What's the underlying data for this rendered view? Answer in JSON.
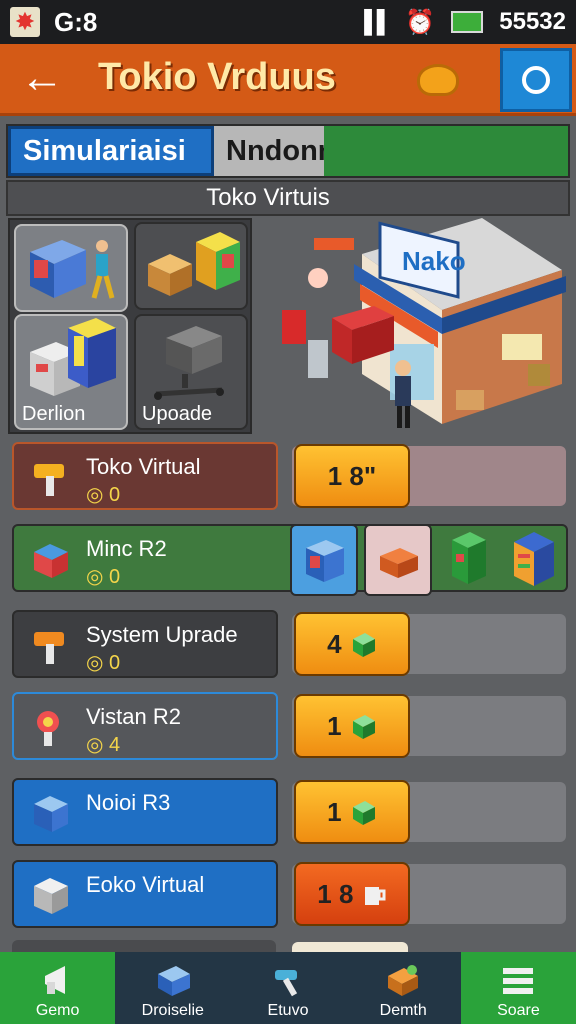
{
  "status": {
    "left_text": "G:8",
    "right_text": "55532"
  },
  "header": {
    "title": "Tokio Vrduus"
  },
  "tabs": [
    {
      "label": "Simulariaisi"
    },
    {
      "label": "Nndonnsial"
    },
    {
      "label": ""
    }
  ],
  "subheader": "Toko Virtuis",
  "categories": [
    {
      "label": ""
    },
    {
      "label": ""
    },
    {
      "label": "Derlion"
    },
    {
      "label": "Upoade"
    }
  ],
  "scene": {
    "sign": "Nako"
  },
  "items": [
    {
      "name": "Toko Virtual",
      "price": "0",
      "button": "1 8\""
    },
    {
      "name": "Minc R2",
      "price": "0",
      "button": ""
    },
    {
      "name": "System Uprade",
      "price": "0",
      "button": "4"
    },
    {
      "name": "Vistan R2",
      "price": "4",
      "button": "1"
    },
    {
      "name": "Noioi R3",
      "price": "",
      "button": "1"
    },
    {
      "name": "Eoko Virtual",
      "price": "",
      "button": "1 8"
    }
  ],
  "nav": [
    {
      "label": "Gemo",
      "icon": "megaphone-icon"
    },
    {
      "label": "Droiselie",
      "icon": "monitor-icon"
    },
    {
      "label": "Etuvo",
      "icon": "tools-icon"
    },
    {
      "label": "Demth",
      "icon": "crate-icon"
    },
    {
      "label": "Soare",
      "icon": "menu-icon"
    }
  ],
  "colors": {
    "accent": "#d45a16",
    "blue": "#1f6fc4",
    "green": "#2aa33a",
    "button": "#ffc232"
  }
}
